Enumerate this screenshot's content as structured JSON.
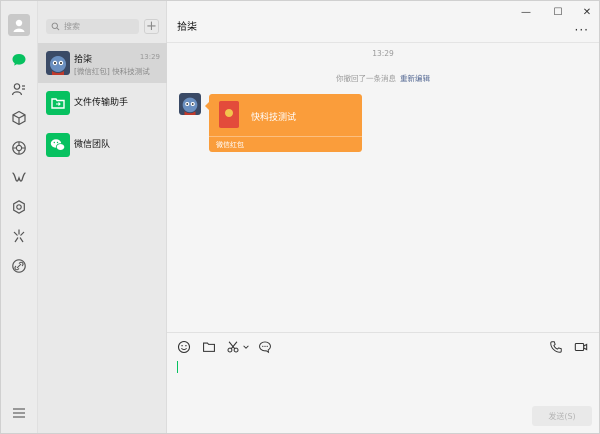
{
  "window": {
    "controls": [
      "—",
      "☐",
      "✕"
    ]
  },
  "rail": {
    "items": [
      "chat-icon",
      "contacts-icon",
      "favorites-icon",
      "moments-icon",
      "channels-icon",
      "mini-programs-icon",
      "search-feature-icon",
      "link-icon"
    ],
    "menu_icon": "menu-icon"
  },
  "search": {
    "placeholder": "搜索",
    "add": "+"
  },
  "conversations": [
    {
      "name": "拾柒",
      "time": "13:29",
      "preview": "[微信红包] 快科技测试"
    },
    {
      "name": "文件传输助手",
      "time": "",
      "preview": ""
    },
    {
      "name": "微信团队",
      "time": "",
      "preview": ""
    }
  ],
  "chat": {
    "title": "拾柒",
    "more": "···",
    "timestamp": "13:29",
    "recall_text": "你撤回了一条消息",
    "recall_link": "重新编辑",
    "red_packet": {
      "title": "快科技测试",
      "footer": "微信红包"
    },
    "send_label": "发送(S)"
  },
  "colors": {
    "accent_green": "#07c160",
    "red_packet": "#fa9d3b",
    "link": "#576b95"
  }
}
